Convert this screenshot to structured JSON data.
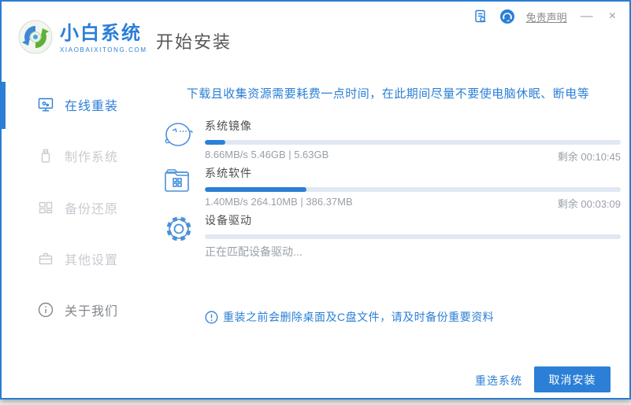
{
  "colors": {
    "accent": "#2b7fd6",
    "window_border": "#2b7cd4",
    "progress_track": "#dfe8f3",
    "dim_text": "#9aa0a8"
  },
  "header": {
    "brand_name": "小白系统",
    "brand_domain": "XIAOBAIXITONG.COM",
    "page_title": "开始安装",
    "disclaimer_link": "免责声明",
    "minimize_label": "—",
    "close_label": "×",
    "icons": [
      "log-document-icon",
      "customer-service-icon"
    ]
  },
  "sidebar": {
    "items": [
      {
        "label": "在线重装",
        "state": "active"
      },
      {
        "label": "制作系统",
        "state": "disabled"
      },
      {
        "label": "备份还原",
        "state": "disabled"
      },
      {
        "label": "其他设置",
        "state": "disabled"
      },
      {
        "label": "关于我们",
        "state": "normal"
      }
    ]
  },
  "main": {
    "warning": "下载且收集资源需要耗费一点时间，在此期间尽量不要使电脑休眠、断电等",
    "sections": [
      {
        "title": "系统镜像",
        "icon": "mascot-face-icon",
        "stats": "8.66MB/s 5.46GB | 5.63GB",
        "remaining": "剩余 00:10:45",
        "percent": 5
      },
      {
        "title": "系统软件",
        "icon": "software-folder-icon",
        "stats": "1.40MB/s 264.10MB | 386.37MB",
        "remaining": "剩余 00:03:09",
        "percent": 24.5
      },
      {
        "title": "设备驱动",
        "icon": "gear-icon",
        "status": "正在匹配设备驱动...",
        "percent": 0
      }
    ],
    "notice": "重装之前会删除桌面及C盘文件，请及时备份重要资料"
  },
  "footer": {
    "reselect_label": "重选系统",
    "cancel_label": "取消安装"
  }
}
